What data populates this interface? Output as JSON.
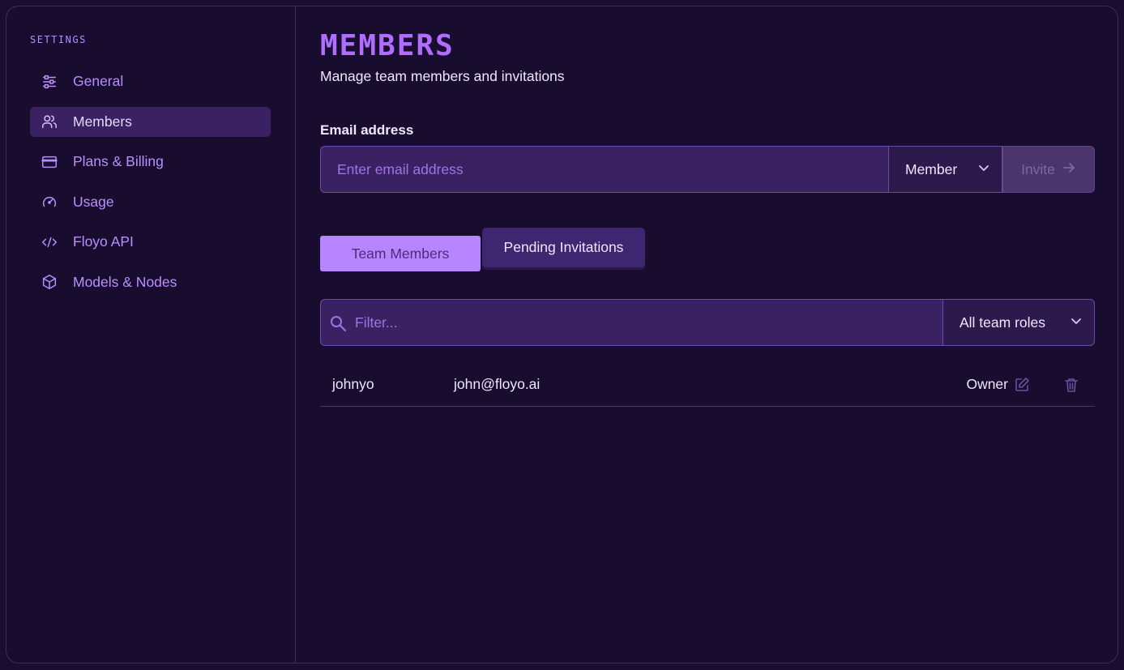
{
  "sidebar": {
    "section_label": "SETTINGS",
    "items": [
      {
        "label": "General",
        "icon": "sliders-icon",
        "active": false
      },
      {
        "label": "Members",
        "icon": "users-icon",
        "active": true
      },
      {
        "label": "Plans & Billing",
        "icon": "credit-card-icon",
        "active": false
      },
      {
        "label": "Usage",
        "icon": "gauge-icon",
        "active": false
      },
      {
        "label": "Floyo API",
        "icon": "code-icon",
        "active": false
      },
      {
        "label": "Models & Nodes",
        "icon": "cube-icon",
        "active": false
      }
    ]
  },
  "main": {
    "title": "MEMBERS",
    "subtitle": "Manage team members and invitations",
    "invite": {
      "email_label": "Email address",
      "email_placeholder": "Enter email address",
      "email_value": "",
      "role_selected": "Member",
      "invite_label": "Invite"
    },
    "tabs": [
      {
        "label": "Team Members",
        "selected": true
      },
      {
        "label": "Pending Invitations",
        "selected": false
      }
    ],
    "filter": {
      "placeholder": "Filter...",
      "roles_selected": "All team roles"
    },
    "members": [
      {
        "username": "johnyo",
        "email": "john@floyo.ai",
        "role": "Owner"
      }
    ]
  },
  "colors": {
    "background": "#190d2f",
    "accent": "#b06dff",
    "active_nav": "#3a2262",
    "tab_selected": "#b685ff"
  }
}
